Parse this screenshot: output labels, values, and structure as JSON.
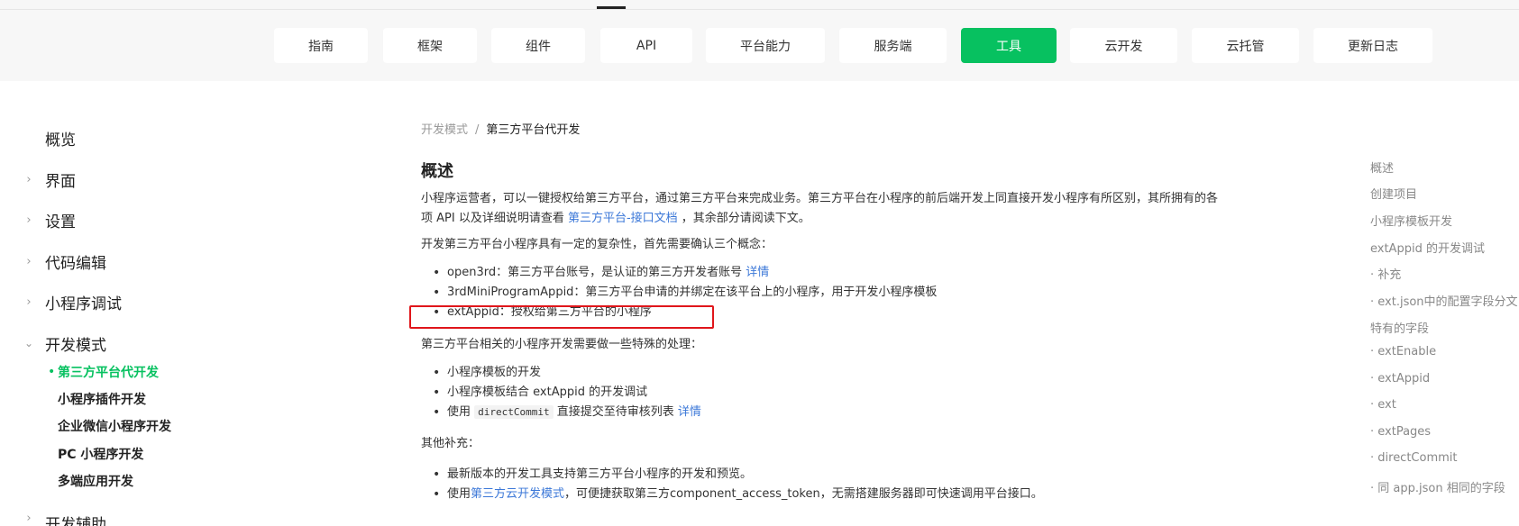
{
  "nav": {
    "tabs": [
      {
        "label": "指南"
      },
      {
        "label": "框架"
      },
      {
        "label": "组件"
      },
      {
        "label": "API"
      },
      {
        "label": "平台能力"
      },
      {
        "label": "服务端"
      },
      {
        "label": "工具",
        "active": true
      },
      {
        "label": "云开发"
      },
      {
        "label": "云托管"
      },
      {
        "label": "更新日志"
      }
    ]
  },
  "sidebar": {
    "items": [
      {
        "label": "概览"
      },
      {
        "label": "界面"
      },
      {
        "label": "设置"
      },
      {
        "label": "代码编辑"
      },
      {
        "label": "小程序调试"
      },
      {
        "label": "开发模式"
      }
    ],
    "sub_items": [
      {
        "label": "第三方平台代开发",
        "active": true
      },
      {
        "label": "小程序插件开发"
      },
      {
        "label": "企业微信小程序开发"
      },
      {
        "label": "PC 小程序开发"
      },
      {
        "label": "多端应用开发"
      }
    ],
    "next_item": "开发辅助"
  },
  "breadcrumb": {
    "parent": "开发模式",
    "sep": "/",
    "current": "第三方平台代开发"
  },
  "content": {
    "title": "概述",
    "intro_1": "小程序运营者，可以一键授权给第三方平台，通过第三方平台来完成业务。第三方平台在小程序的前后端开发上同直接开发小程序有所区别，其所拥有的各",
    "intro_2a": "项 API 以及详细说明请查看 ",
    "intro_2_link": "第三方平台-接口文档",
    "intro_2b": " ，其余部分请阅读下文。",
    "concepts_intro": "开发第三方平台小程序具有一定的复杂性，首先需要确认三个概念：",
    "concept_1": "open3rd：第三方平台账号，是认证的第三方开发者账号 ",
    "concept_1_link": "详情",
    "concept_2": "3rdMiniProgramAppid：第三方平台申请的并绑定在该平台上的小程序，用于开发小程序模板",
    "concept_3": "extAppid：授权给第三方平台的小程序",
    "special_intro": "第三方平台相关的小程序开发需要做一些特殊的处理：",
    "special_1": "小程序模板的开发",
    "special_2": "小程序模板结合 extAppid 的开发调试",
    "special_3a": "使用 ",
    "special_3_code": "directCommit",
    "special_3b": " 直接提交至待审核列表 ",
    "special_3_link": "详情",
    "other_intro": "其他补充：",
    "other_1": "最新版本的开发工具支持第三方平台小程序的开发和预览。",
    "other_2a": "使用",
    "other_2_link": "第三方云开发模式",
    "other_2b": "，可便捷获取第三方component_access_token，无需搭建服务器即可快速调用平台接口。"
  },
  "toc": {
    "items": [
      "概述",
      "创建项目",
      "小程序模板开发",
      "extAppid 的开发调试",
      "· 补充",
      "· ext.json中的配置字段分文",
      "特有的字段",
      "· extEnable",
      "· extAppid",
      "· ext",
      "· extPages",
      "· directCommit",
      "· 同 app.json 相同的字段"
    ]
  },
  "colors": {
    "accent": "#07c160",
    "link": "#3c78d8",
    "highlight": "#e0161b"
  },
  "icons": {
    "collapsed": "chevron-right-icon",
    "expanded": "chevron-down-icon"
  }
}
